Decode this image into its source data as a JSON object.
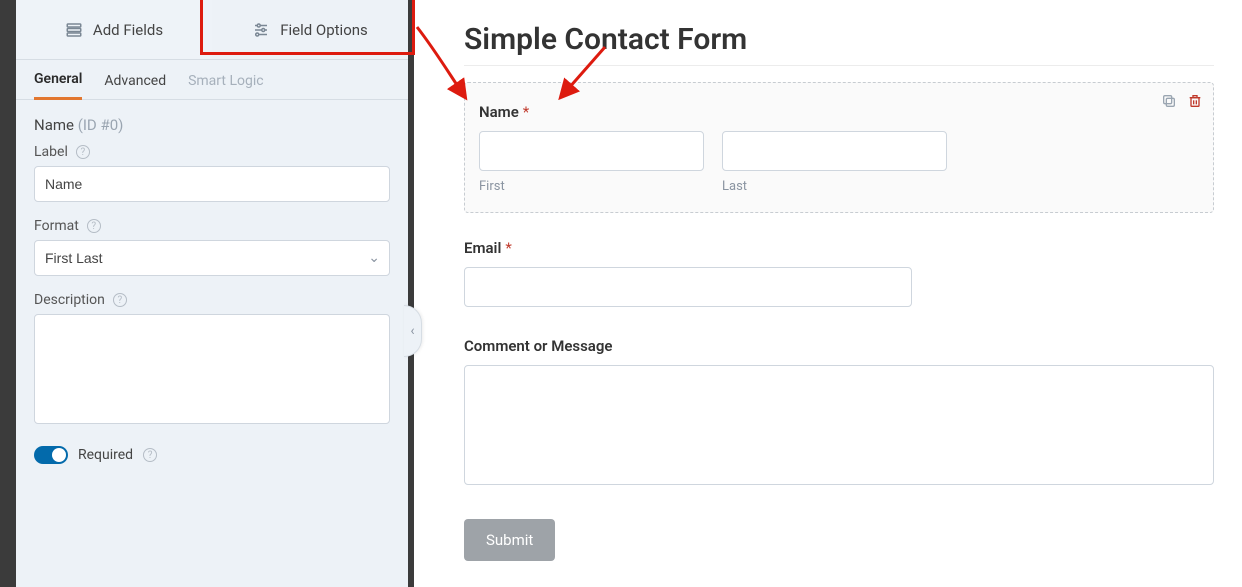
{
  "sidebar": {
    "top_tabs": {
      "add_fields": "Add Fields",
      "field_options": "Field Options"
    },
    "sub_tabs": {
      "general": "General",
      "advanced": "Advanced",
      "smart_logic": "Smart Logic"
    },
    "field_heading": {
      "name": "Name",
      "id_suffix": "(ID #0)"
    },
    "label_section": {
      "label": "Label",
      "value": "Name"
    },
    "format_section": {
      "label": "Format",
      "value": "First Last"
    },
    "description_section": {
      "label": "Description",
      "value": ""
    },
    "required_label": "Required"
  },
  "icons": {
    "help_glyph": "?",
    "chev_down": "⌄",
    "chev_left": "‹"
  },
  "main": {
    "title": "Simple Contact Form",
    "fields": {
      "name": {
        "label": "Name",
        "first_value": "",
        "last_value": "",
        "first_sub": "First",
        "last_sub": "Last"
      },
      "email": {
        "label": "Email",
        "value": ""
      },
      "comment": {
        "label": "Comment or Message",
        "value": ""
      }
    },
    "submit_label": "Submit"
  }
}
